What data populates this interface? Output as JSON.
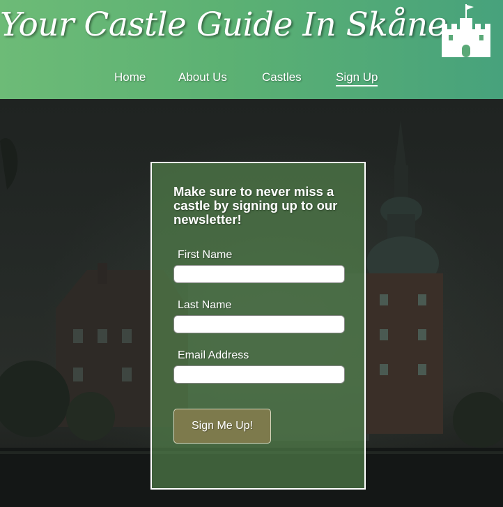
{
  "header": {
    "title": "Your Castle Guide In Skåne",
    "logo_icon": "castle-icon"
  },
  "nav": {
    "items": [
      {
        "label": "Home"
      },
      {
        "label": "About Us"
      },
      {
        "label": "Castles"
      },
      {
        "label": "Sign Up"
      }
    ],
    "active": "Sign Up"
  },
  "signup": {
    "heading": "Make sure to never miss a castle by signing up to our newsletter!",
    "first_name_label": "First Name",
    "first_name_value": "",
    "last_name_label": "Last Name",
    "last_name_value": "",
    "email_label": "Email Address",
    "email_value": "",
    "submit_label": "Sign Me Up!"
  },
  "colors": {
    "header_start": "#6dbb77",
    "header_end": "#47a27c",
    "form_panel": "#588c50",
    "button": "#7d7a4c"
  }
}
